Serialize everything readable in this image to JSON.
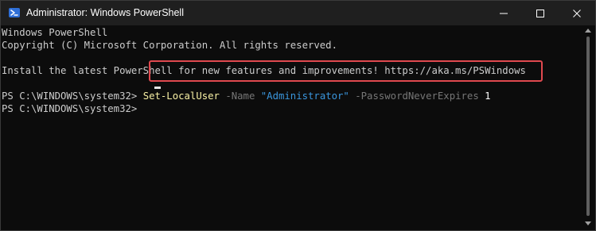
{
  "window": {
    "title": "Administrator: Windows PowerShell",
    "icon": "powershell-icon",
    "controls": [
      "minimize-icon",
      "maximize-icon",
      "close-icon"
    ]
  },
  "console": {
    "lines": {
      "banner": "Windows PowerShell",
      "copyright": "Copyright (C) Microsoft Corporation. All rights reserved.",
      "install_tip": "Install the latest PowerShell for new features and improvements! https://aka.ms/PSWindows"
    },
    "prompt": "PS C:\\WINDOWS\\system32> ",
    "command": {
      "cmdlet": "Set-LocalUser",
      "param_name_flag": "-Name",
      "name_value": "\"Administrator\"",
      "param_expires_flag": "-PasswordNeverExpires",
      "expires_value": "1"
    },
    "colors": {
      "background": "#0c0c0c",
      "text": "#cccccc",
      "cmdlet": "#f9f1a5",
      "parameter": "#767676",
      "string": "#3a96dd",
      "highlight_border": "#e0494f"
    }
  }
}
